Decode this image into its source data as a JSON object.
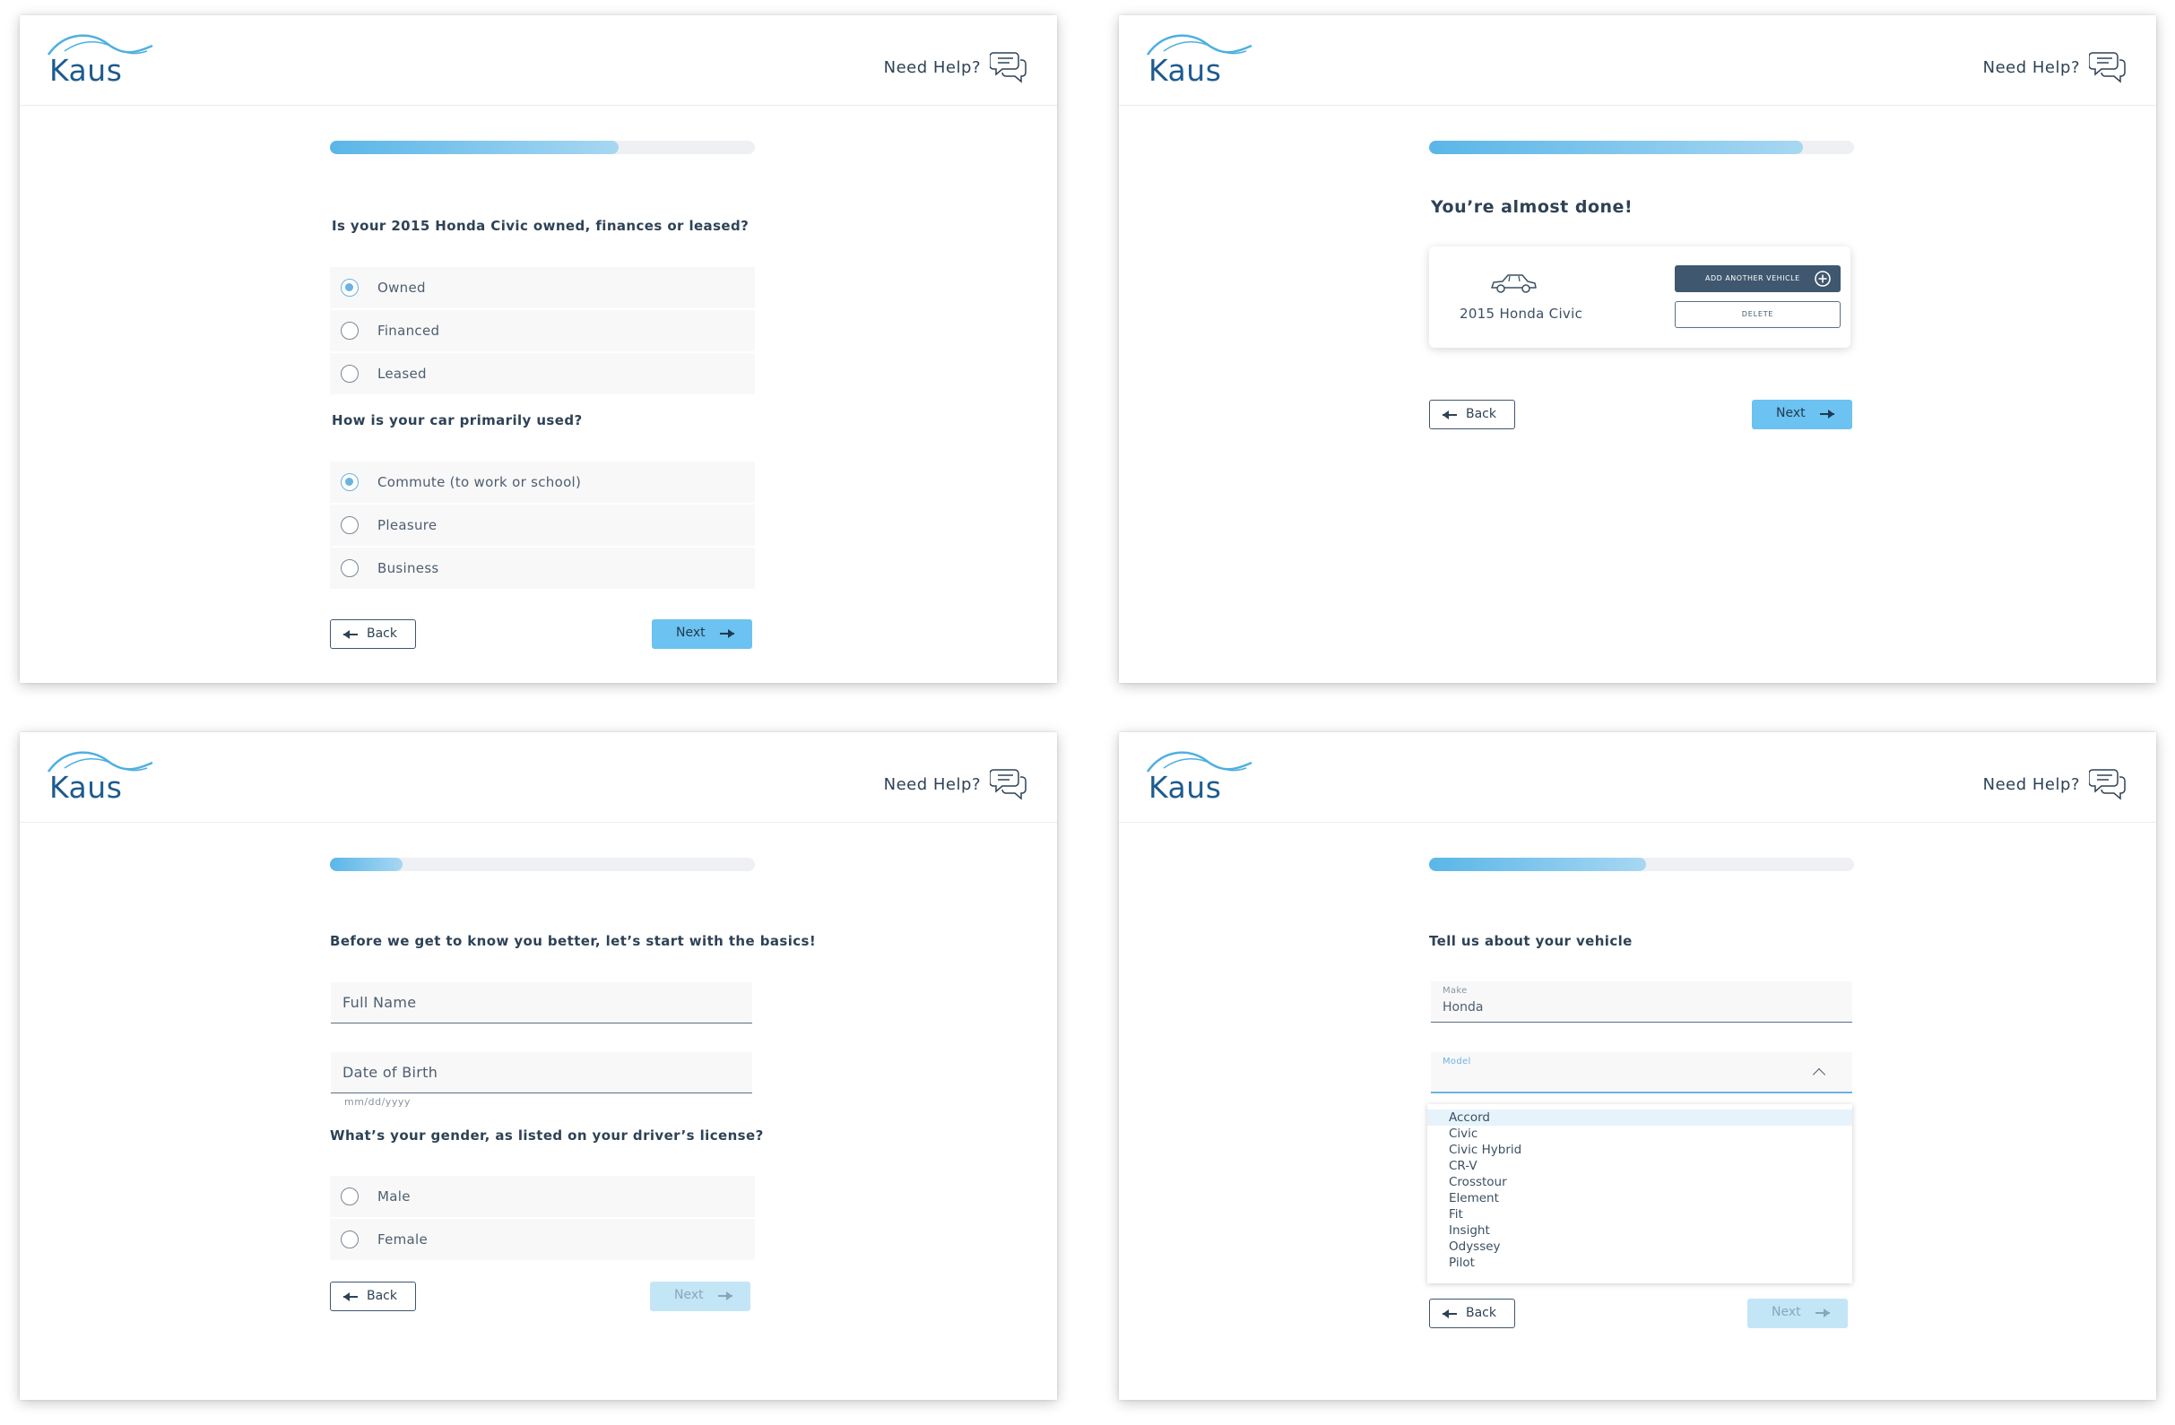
{
  "brand": {
    "logo_text": "Kaus",
    "help_label": "Need Help?"
  },
  "colors": {
    "accent": "#6cc2f0",
    "dark": "#3f576f",
    "text": "#2e4256"
  },
  "icons": {
    "help": "chat-bubbles-icon",
    "back": "arrow-left-icon",
    "next": "arrow-right-icon",
    "car": "car-icon",
    "add": "plus-circle-icon",
    "dropdown": "chevron-up-icon"
  },
  "buttons": {
    "back": "Back",
    "next": "Next"
  },
  "screen_ownership": {
    "progress_percent": 68,
    "q1": "Is your 2015 Honda Civic owned, finances or leased?",
    "q1_options": [
      "Owned",
      "Financed",
      "Leased"
    ],
    "q1_selected": "Owned",
    "q2": "How is your car primarily used?",
    "q2_options": [
      "Commute (to work or school)",
      "Pleasure",
      "Business"
    ],
    "q2_selected": "Commute (to work or school)"
  },
  "screen_almost_done": {
    "progress_percent": 88,
    "heading": "You’re almost done!",
    "vehicle": "2015 Honda Civic",
    "add_vehicle": "ADD ANOTHER VEHICLE",
    "delete": "DELETE"
  },
  "screen_basics": {
    "progress_percent": 17,
    "heading": "Before we get to know you better, let’s start with the basics!",
    "full_name_placeholder": "Full Name",
    "dob_placeholder": "Date of Birth",
    "dob_hint": "mm/dd/yyyy",
    "gender_question": "What’s your gender, as listed on your driver’s license?",
    "gender_options": [
      "Male",
      "Female"
    ]
  },
  "screen_vehicle": {
    "progress_percent": 51,
    "heading": "Tell us about your vehicle",
    "make_label": "Make",
    "make_value": "Honda",
    "model_label": "Model",
    "model_options": [
      "Accord",
      "Civic",
      "Civic Hybrid",
      "CR-V",
      "Crosstour",
      "Element",
      "Fit",
      "Insight",
      "Odyssey",
      "Pilot"
    ],
    "model_highlighted": "Accord"
  }
}
